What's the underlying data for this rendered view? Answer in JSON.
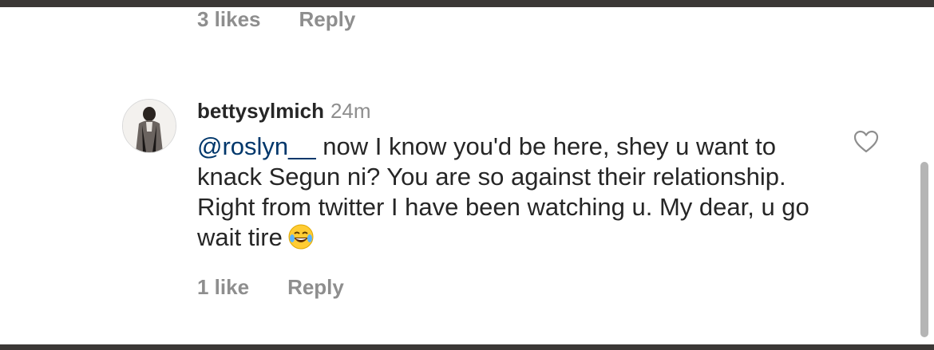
{
  "previous_comment": {
    "likes_label": "3 likes",
    "reply_label": "Reply"
  },
  "comment": {
    "username": "bettysylmich",
    "time": "24m",
    "mention": "@roslyn__",
    "text": " now I know you'd be here, shey u want to knack Segun ni? You are so against their relationship. Right from twitter I have been watching u. My dear, u go wait tire",
    "emoji": "laughing-with-tears-emoji",
    "likes_label": "1 like",
    "reply_label": "Reply",
    "like_icon": "heart-outline-icon",
    "avatar_icon": "user-avatar"
  },
  "colors": {
    "frame": "#3b3836",
    "background": "#ffffff",
    "primary_text": "#262626",
    "secondary_text": "#8e8e8e",
    "mention": "#00376b",
    "scrollbar": "#b5b5b5"
  }
}
